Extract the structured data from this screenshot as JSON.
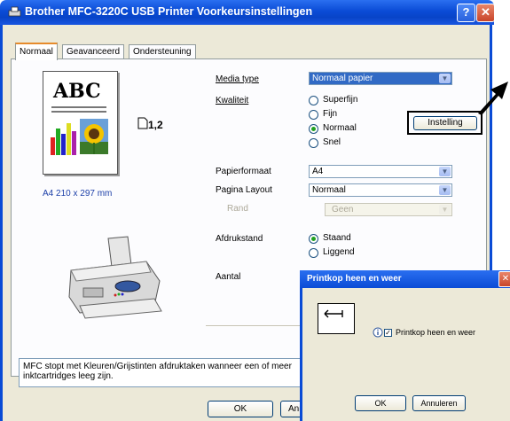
{
  "window": {
    "title": "Brother MFC-3220C USB Printer Voorkeursinstellingen",
    "help": "?",
    "close": "✕"
  },
  "tabs": [
    {
      "label": "Normaal"
    },
    {
      "label": "Geavanceerd"
    },
    {
      "label": "Ondersteuning"
    }
  ],
  "preview": {
    "abc": "ABC",
    "paper_size_text": "A4 210 x 297 mm",
    "copies_indicator": "1,2"
  },
  "media_type": {
    "label": "Media type",
    "value": "Normaal papier"
  },
  "kwaliteit": {
    "label": "Kwaliteit",
    "options": [
      "Superfijn",
      "Fijn",
      "Normaal",
      "Snel"
    ],
    "selected": "Normaal"
  },
  "instelling_button": "Instelling",
  "papierformaat": {
    "label": "Papierformaat",
    "value": "A4"
  },
  "pagina_layout": {
    "label": "Pagina Layout",
    "value": "Normaal"
  },
  "rand": {
    "label": "Rand",
    "value": "Geen"
  },
  "afdrukstand": {
    "label": "Afdrukstand",
    "options": [
      "Staand",
      "Liggend"
    ],
    "selected": "Staand"
  },
  "aantal": {
    "label": "Aantal"
  },
  "status_message": "MFC stopt met Kleuren/Grijstinten afdruktaken wanneer een of meer inktcartridges leeg zijn.",
  "footer": {
    "ok": "OK",
    "cancel_partial": "Ann"
  },
  "dialog": {
    "title": "Printkop heen en weer",
    "close": "✕",
    "checkbox_label": "Printkop heen en weer",
    "checked": true,
    "ok": "OK",
    "cancel": "Annuleren"
  },
  "colors": {
    "xp_blue": "#0a4bd6",
    "face": "#ece9d8",
    "select_blue": "#316ac5"
  }
}
